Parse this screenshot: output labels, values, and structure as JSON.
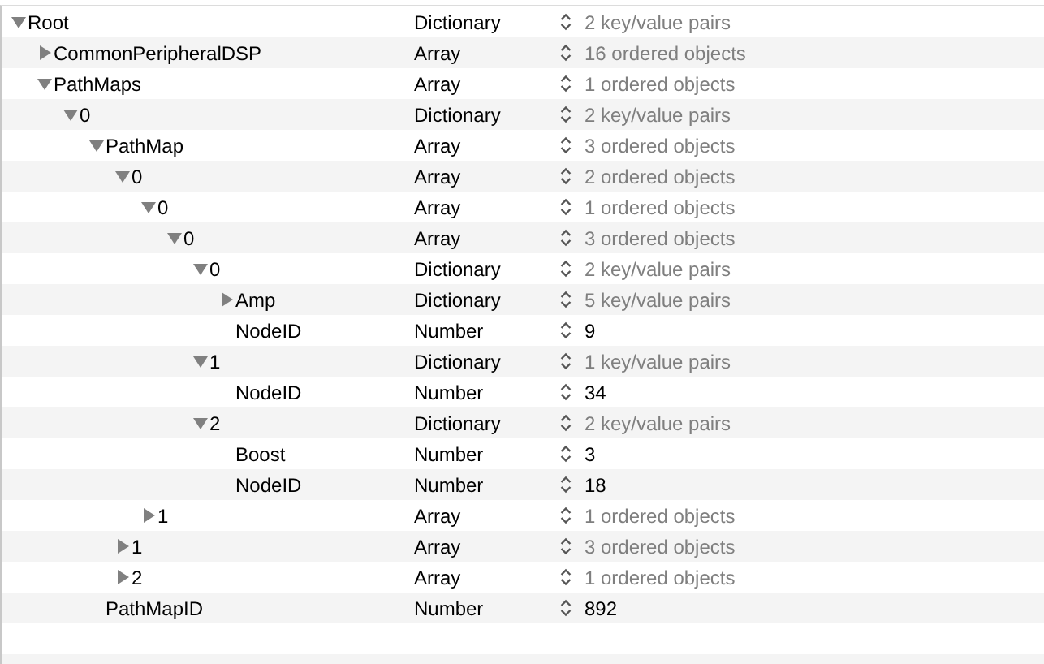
{
  "tree": [
    {
      "key": "Root",
      "type": "Dictionary",
      "value": "2 key/value pairs",
      "kind": "container",
      "expanded": true,
      "children": [
        {
          "key": "CommonPeripheralDSP",
          "type": "Array",
          "value": "16 ordered objects",
          "kind": "container",
          "expanded": false
        },
        {
          "key": "PathMaps",
          "type": "Array",
          "value": "1 ordered objects",
          "kind": "container",
          "expanded": true,
          "children": [
            {
              "key": "0",
              "type": "Dictionary",
              "value": "2 key/value pairs",
              "kind": "container",
              "expanded": true,
              "children": [
                {
                  "key": "PathMap",
                  "type": "Array",
                  "value": "3 ordered objects",
                  "kind": "container",
                  "expanded": true,
                  "children": [
                    {
                      "key": "0",
                      "type": "Array",
                      "value": "2 ordered objects",
                      "kind": "container",
                      "expanded": true,
                      "children": [
                        {
                          "key": "0",
                          "type": "Array",
                          "value": "1 ordered objects",
                          "kind": "container",
                          "expanded": true,
                          "children": [
                            {
                              "key": "0",
                              "type": "Array",
                              "value": "3 ordered objects",
                              "kind": "container",
                              "expanded": true,
                              "children": [
                                {
                                  "key": "0",
                                  "type": "Dictionary",
                                  "value": "2 key/value pairs",
                                  "kind": "container",
                                  "expanded": true,
                                  "children": [
                                    {
                                      "key": "Amp",
                                      "type": "Dictionary",
                                      "value": "5 key/value pairs",
                                      "kind": "container",
                                      "expanded": false
                                    },
                                    {
                                      "key": "NodeID",
                                      "type": "Number",
                                      "value": "9",
                                      "kind": "value"
                                    }
                                  ]
                                },
                                {
                                  "key": "1",
                                  "type": "Dictionary",
                                  "value": "1 key/value pairs",
                                  "kind": "container",
                                  "expanded": true,
                                  "children": [
                                    {
                                      "key": "NodeID",
                                      "type": "Number",
                                      "value": "34",
                                      "kind": "value"
                                    }
                                  ]
                                },
                                {
                                  "key": "2",
                                  "type": "Dictionary",
                                  "value": "2 key/value pairs",
                                  "kind": "container",
                                  "expanded": true,
                                  "children": [
                                    {
                                      "key": "Boost",
                                      "type": "Number",
                                      "value": "3",
                                      "kind": "value"
                                    },
                                    {
                                      "key": "NodeID",
                                      "type": "Number",
                                      "value": "18",
                                      "kind": "value"
                                    }
                                  ]
                                }
                              ]
                            }
                          ]
                        },
                        {
                          "key": "1",
                          "type": "Array",
                          "value": "1 ordered objects",
                          "kind": "container",
                          "expanded": false
                        }
                      ]
                    },
                    {
                      "key": "1",
                      "type": "Array",
                      "value": "3 ordered objects",
                      "kind": "container",
                      "expanded": false
                    },
                    {
                      "key": "2",
                      "type": "Array",
                      "value": "1 ordered objects",
                      "kind": "container",
                      "expanded": false
                    }
                  ]
                },
                {
                  "key": "PathMapID",
                  "type": "Number",
                  "value": "892",
                  "kind": "value"
                }
              ]
            }
          ]
        }
      ]
    }
  ]
}
